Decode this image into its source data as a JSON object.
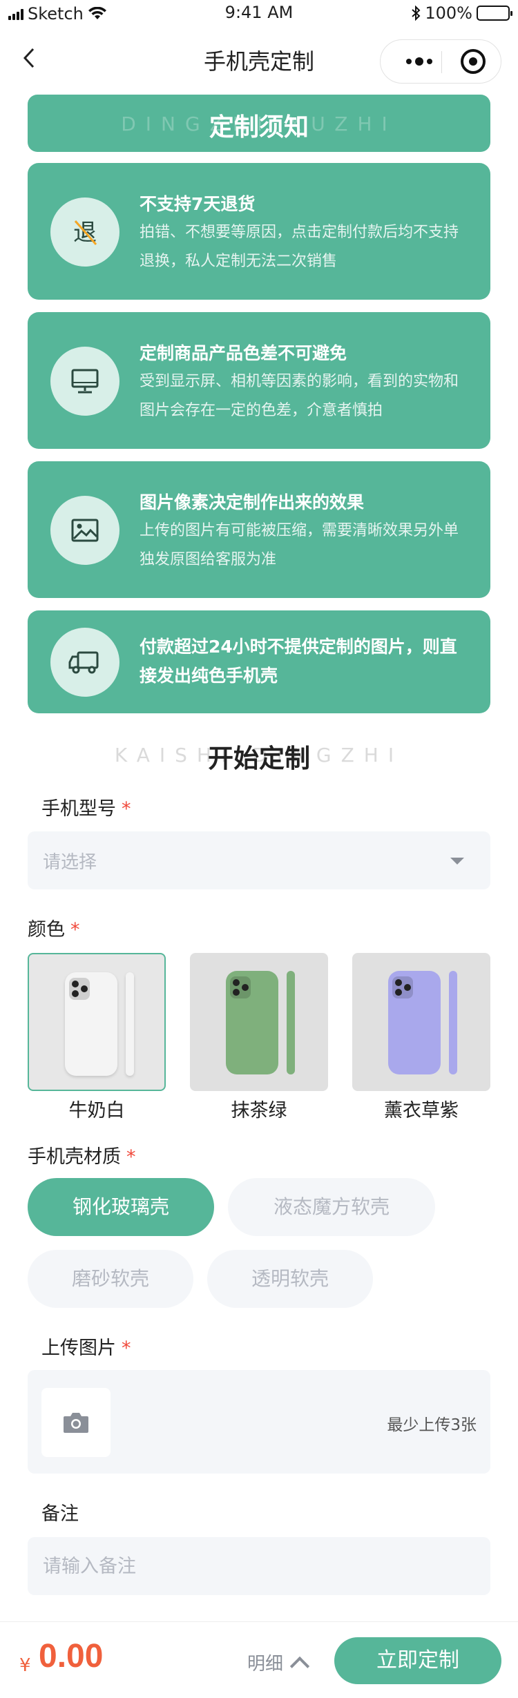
{
  "status_bar": {
    "carrier": "Sketch",
    "time": "9:41 AM",
    "battery": "100%"
  },
  "nav": {
    "title": "手机壳定制"
  },
  "notice": {
    "title": "定制须知",
    "watermark": "DINGZHI XUZHI",
    "cards": [
      {
        "icon": "no-return-icon",
        "title": "不支持7天退货",
        "desc": "拍错、不想要等原因，点击定制付款后均不支持退换，私人定制无法二次销售"
      },
      {
        "icon": "monitor-icon",
        "title": "定制商品产品色差不可避免",
        "desc": "受到显示屏、相机等因素的影响，看到的实物和图片会存在一定的色差，介意者慎拍"
      },
      {
        "icon": "image-icon",
        "title": "图片像素决定制作出来的效果",
        "desc": "上传的图片有可能被压缩，需要清晰效果另外单独发原图给客服为准"
      },
      {
        "icon": "truck-icon",
        "title": "付款超过24小时不提供定制的图片，则直接发出纯色手机壳"
      }
    ]
  },
  "start": {
    "title": "开始定制",
    "watermark": "KAISHI DINGZHI"
  },
  "form": {
    "required_mark": "*",
    "model": {
      "label": "手机型号",
      "placeholder": "请选择"
    },
    "color": {
      "label": "颜色",
      "options": [
        {
          "name": "牛奶白",
          "color": "#f4f4f4",
          "selected": true
        },
        {
          "name": "抹茶绿",
          "color": "#7fb07c",
          "selected": false
        },
        {
          "name": "薰衣草紫",
          "color": "#a9a8ec",
          "selected": false
        }
      ]
    },
    "material": {
      "label": "手机壳材质",
      "options": [
        {
          "name": "钢化玻璃壳",
          "active": true
        },
        {
          "name": "液态魔方软壳",
          "active": false
        },
        {
          "name": "磨砂软壳",
          "active": false
        },
        {
          "name": "透明软壳",
          "active": false
        }
      ]
    },
    "upload": {
      "label": "上传图片",
      "hint": "最少上传3张"
    },
    "remark": {
      "label": "备注",
      "placeholder": "请输入备注"
    }
  },
  "bottom": {
    "currency": "¥",
    "price": "0.00",
    "detail": "明细",
    "submit": "立即定制"
  },
  "colors": {
    "accent": "#56b699",
    "price": "#f0603c",
    "required": "#f04a3c"
  }
}
